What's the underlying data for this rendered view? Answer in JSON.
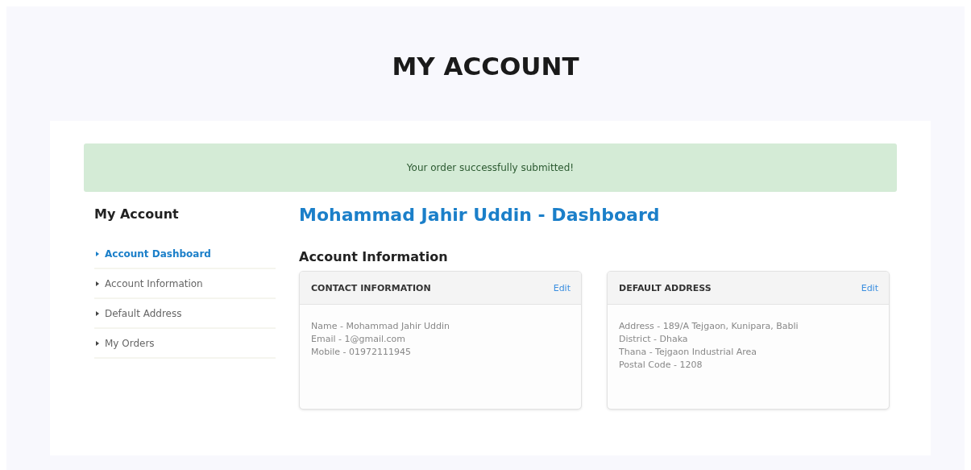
{
  "page_title": "MY ACCOUNT",
  "alert": {
    "message": "Your order successfully submitted!"
  },
  "sidebar": {
    "title": "My Account",
    "items": [
      {
        "label": "Account Dashboard",
        "selected": true
      },
      {
        "label": "Account Information",
        "selected": false
      },
      {
        "label": "Default Address",
        "selected": false
      },
      {
        "label": "My Orders",
        "selected": false
      }
    ]
  },
  "dashboard_title": "Mohammad Jahir Uddin - Dashboard",
  "section_title": "Account Information",
  "cards": [
    {
      "title": "CONTACT INFORMATION",
      "action": "Edit",
      "lines": [
        "Name - Mohammad Jahir Uddin",
        "Email - 1@gmail.com",
        "Mobile - 01972111945"
      ]
    },
    {
      "title": "DEFAULT ADDRESS",
      "action": "Edit",
      "lines": [
        "Address - 189/A Tejgaon, Kunipara, Babli",
        "District - Dhaka",
        "Thana - Tejgaon Industrial Area",
        "Postal Code - 1208"
      ]
    }
  ]
}
